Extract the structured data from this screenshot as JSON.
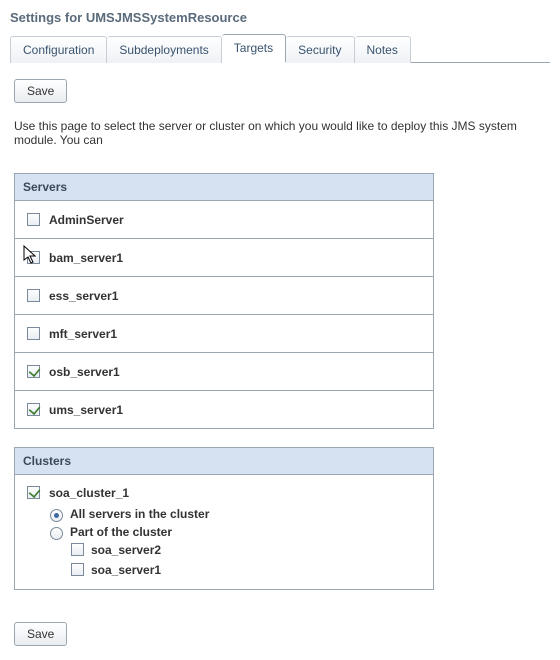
{
  "title": "Settings for UMSJMSSystemResource",
  "tabs": {
    "configuration": "Configuration",
    "subdeployments": "Subdeployments",
    "targets": "Targets",
    "security": "Security",
    "notes": "Notes",
    "active": "targets"
  },
  "buttons": {
    "save": "Save"
  },
  "intro": "Use this page to select the server or cluster on which you would like to deploy this JMS system module. You can",
  "servers": {
    "header": "Servers",
    "items": [
      {
        "name": "AdminServer",
        "checked": false
      },
      {
        "name": "bam_server1",
        "checked": false
      },
      {
        "name": "ess_server1",
        "checked": false
      },
      {
        "name": "mft_server1",
        "checked": false
      },
      {
        "name": "osb_server1",
        "checked": true
      },
      {
        "name": "ums_server1",
        "checked": true
      }
    ]
  },
  "clusters": {
    "header": "Clusters",
    "items": [
      {
        "name": "soa_cluster_1",
        "checked": true,
        "mode": {
          "all": {
            "label": "All servers in the cluster",
            "selected": true
          },
          "part": {
            "label": "Part of the cluster",
            "selected": false
          }
        },
        "members": [
          {
            "name": "soa_server2",
            "checked": false
          },
          {
            "name": "soa_server1",
            "checked": false
          }
        ]
      }
    ]
  }
}
